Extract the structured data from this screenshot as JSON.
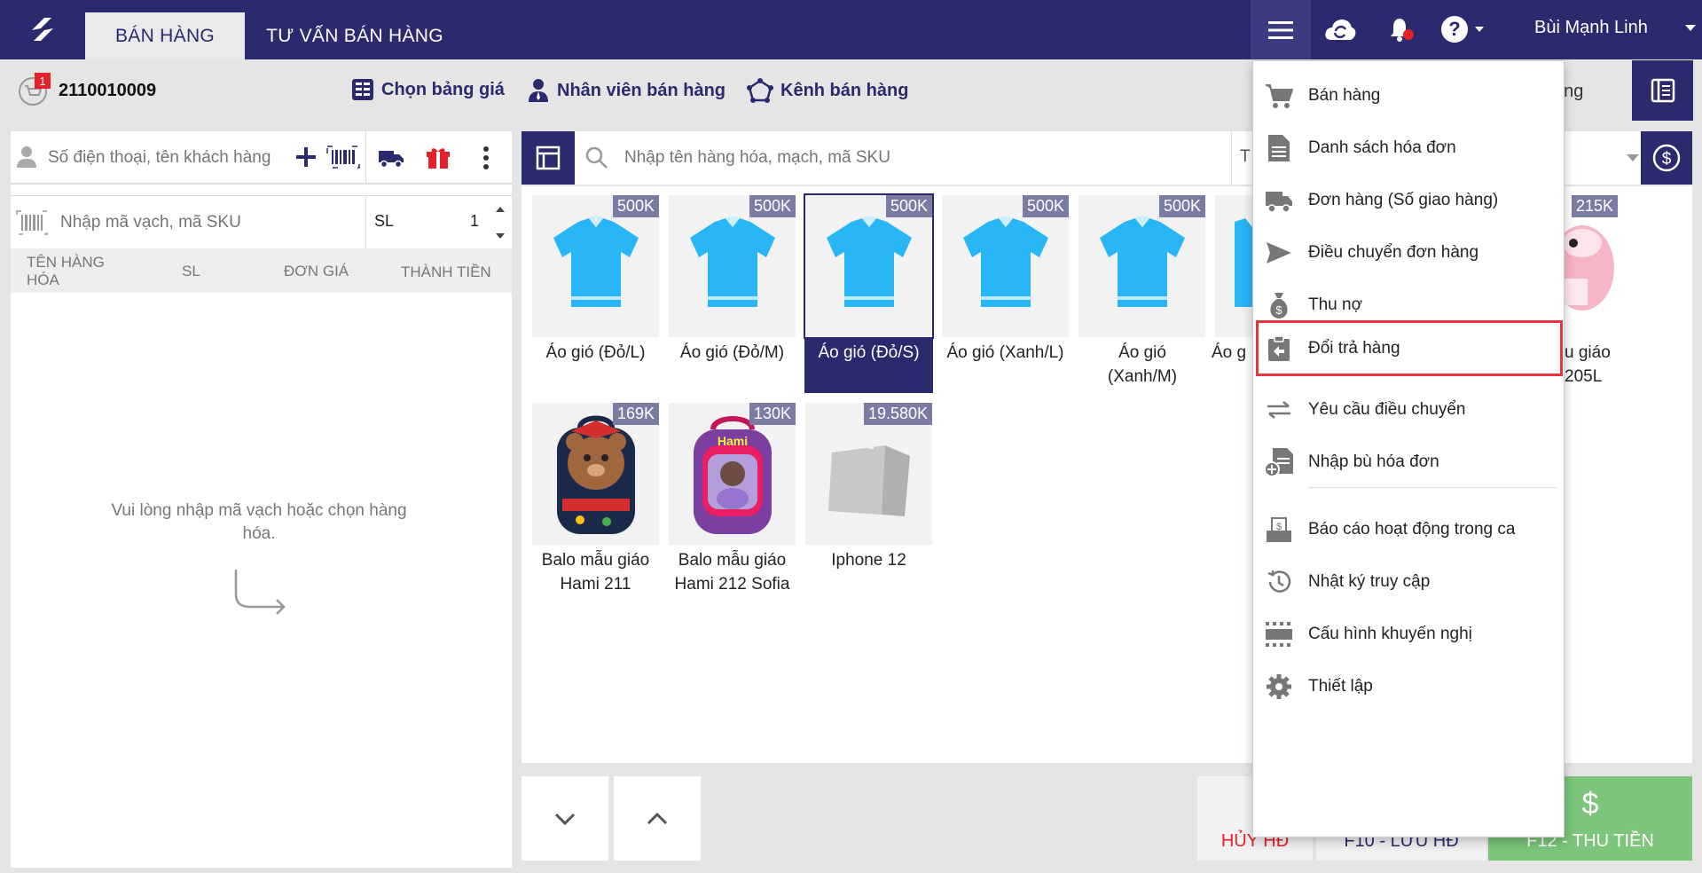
{
  "header": {
    "tabs": [
      {
        "label": "BÁN HÀNG",
        "active": true
      },
      {
        "label": "TƯ VẤN BÁN HÀNG",
        "active": false
      }
    ],
    "username": "Bùi Mạnh Linh",
    "icons": [
      "menu-icon",
      "cloud-sync-icon",
      "notification-bell-icon",
      "help-icon"
    ]
  },
  "toolbar": {
    "order_number": "2110010009",
    "cart_badge": "1",
    "price_list_label": "Chọn bảng giá",
    "staff_label": "Nhân viên bán hàng",
    "channel_label": "Kênh bán hàng",
    "right_fragment": "ông"
  },
  "customer": {
    "placeholder": "Số điện thoại, tên khách hàng"
  },
  "sku_input": {
    "placeholder": "Nhập mã vạch, mã SKU",
    "qty_label": "SL",
    "qty_value": "1"
  },
  "cart_table": {
    "headers": [
      "TÊN HÀNG HÓA",
      "SL",
      "ĐƠN GIÁ",
      "THÀNH TIỀN"
    ],
    "empty_message": "Vui lòng nhập mã vạch hoặc chọn hàng hóa."
  },
  "product_search": {
    "placeholder": "Nhập tên hàng hóa, mạch, mã SKU",
    "category_fragment": "T"
  },
  "products": [
    {
      "name": "Áo gió (Đỏ/L)",
      "price": "500K",
      "image": "tshirt"
    },
    {
      "name": "Áo gió (Đỏ/M)",
      "price": "500K",
      "image": "tshirt"
    },
    {
      "name": "Áo gió (Đỏ/S)",
      "price": "500K",
      "image": "tshirt",
      "selected": true
    },
    {
      "name": "Áo gió (Xanh/L)",
      "price": "500K",
      "image": "tshirt"
    },
    {
      "name": "Áo gió (Xanh/M)",
      "price": "500K",
      "image": "tshirt"
    },
    {
      "name": "Áo g",
      "price": "",
      "image": "tshirt"
    },
    {
      "name": "u giáo 205L",
      "price": "215K",
      "image": "backpack-pink"
    },
    {
      "name": "Balo mẫu giáo Hami 211",
      "price": "169K",
      "image": "backpack-bear"
    },
    {
      "name": "Balo mẫu giáo Hami 212 Sofia",
      "price": "130K",
      "image": "backpack-sofia"
    },
    {
      "name": "Iphone 12",
      "price": "19.580K",
      "image": "shopping-bag"
    }
  ],
  "bottom": {
    "cancel_label": "HỦY HĐ",
    "save_label": "F10 - LƯU HĐ",
    "pay_label": "F12 - THU TIỀN"
  },
  "menu": {
    "items": [
      {
        "label": "Bán hàng",
        "icon": "cart-icon"
      },
      {
        "label": "Danh sách hóa đơn",
        "icon": "document-icon"
      },
      {
        "label": "Đơn hàng (Số giao hàng)",
        "icon": "delivery-icon"
      },
      {
        "label": "Điều chuyển đơn hàng",
        "icon": "send-icon"
      },
      {
        "label": "Thu nợ",
        "icon": "money-bag-icon"
      },
      {
        "label": "Đổi trả hàng",
        "icon": "return-icon",
        "highlighted": true
      },
      {
        "label": "Yêu cầu điều chuyển",
        "icon": "transfer-icon"
      },
      {
        "label": "Nhập bù hóa đơn",
        "icon": "add-invoice-icon"
      },
      {
        "label": "Báo cáo hoạt động trong ca",
        "icon": "report-icon"
      },
      {
        "label": "Nhật ký truy cập",
        "icon": "history-icon"
      },
      {
        "label": "Cấu hình khuyến nghị",
        "icon": "config-icon"
      },
      {
        "label": "Thiết lập",
        "icon": "settings-icon"
      }
    ]
  },
  "colors": {
    "primary": "#2b2a6e",
    "accent_red": "#e2373f",
    "pay_green": "#7cc57a",
    "price_tag": "#7b7ca4"
  }
}
